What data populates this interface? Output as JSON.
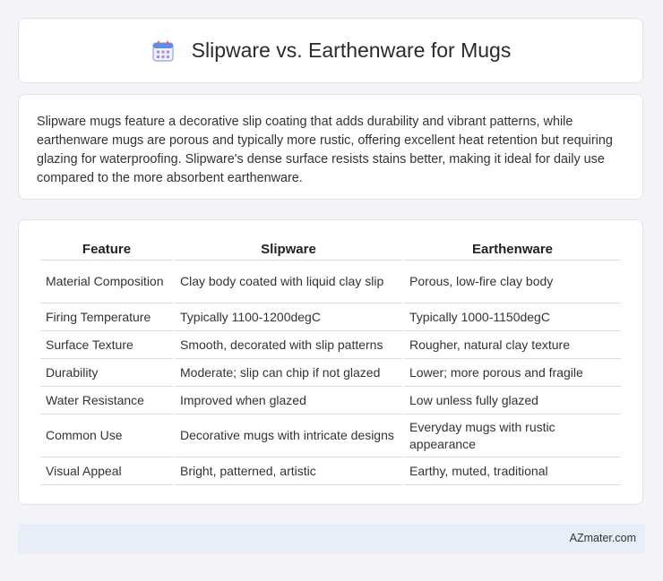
{
  "header": {
    "title": "Slipware vs. Earthenware for Mugs",
    "icon": "calendar-icon"
  },
  "summary": {
    "text": "Slipware mugs feature a decorative slip coating that adds durability and vibrant patterns, while earthenware mugs are porous and typically more rustic, offering excellent heat retention but requiring glazing for waterproofing. Slipware's dense surface resists stains better, making it ideal for daily use compared to the more absorbent earthenware."
  },
  "table": {
    "headers": [
      "Feature",
      "Slipware",
      "Earthenware"
    ],
    "rows": [
      [
        "Material Composition",
        "Clay body coated with liquid clay slip",
        "Porous, low-fire clay body"
      ],
      [
        "Firing Temperature",
        "Typically 1100-1200degC",
        "Typically 1000-1150degC"
      ],
      [
        "Surface Texture",
        "Smooth, decorated with slip patterns",
        "Rougher, natural clay texture"
      ],
      [
        "Durability",
        "Moderate; slip can chip if not glazed",
        "Lower; more porous and fragile"
      ],
      [
        "Water Resistance",
        "Improved when glazed",
        "Low unless fully glazed"
      ],
      [
        "Common Use",
        "Decorative mugs with intricate designs",
        "Everyday mugs with rustic appearance"
      ],
      [
        "Visual Appeal",
        "Bright, patterned, artistic",
        "Earthy, muted, traditional"
      ]
    ]
  },
  "footer": {
    "brand": "AZmater.com"
  }
}
